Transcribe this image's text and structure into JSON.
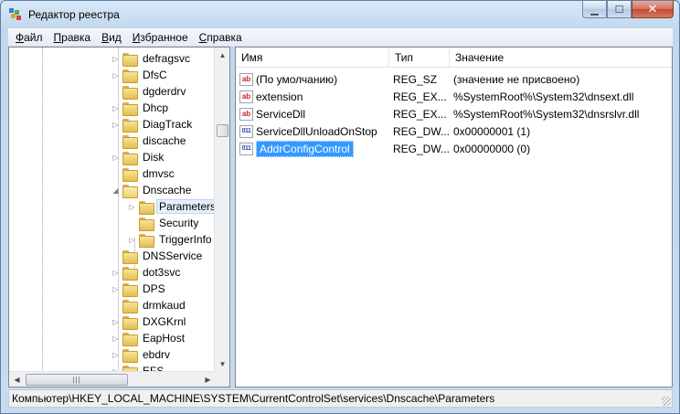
{
  "window": {
    "title": "Редактор реестра"
  },
  "caption": {
    "minimize": "▁",
    "maximize": "☐",
    "close": "✕"
  },
  "menu": [
    {
      "first": "Ф",
      "rest": "айл"
    },
    {
      "first": "П",
      "rest": "равка"
    },
    {
      "first": "В",
      "rest": "ид"
    },
    {
      "first": "И",
      "rest": "збранное"
    },
    {
      "first": "С",
      "rest": "правка"
    }
  ],
  "tree": {
    "items": [
      {
        "label": "defragsvc",
        "expander": "▷",
        "level": 0
      },
      {
        "label": "DfsC",
        "expander": "▷",
        "level": 0
      },
      {
        "label": "dgderdrv",
        "expander": "",
        "level": 0
      },
      {
        "label": "Dhcp",
        "expander": "▷",
        "level": 0
      },
      {
        "label": "DiagTrack",
        "expander": "▷",
        "level": 0
      },
      {
        "label": "discache",
        "expander": "",
        "level": 0
      },
      {
        "label": "Disk",
        "expander": "▷",
        "level": 0
      },
      {
        "label": "dmvsc",
        "expander": "",
        "level": 0
      },
      {
        "label": "Dnscache",
        "expander": "◢",
        "level": 0
      },
      {
        "label": "Parameters",
        "expander": "▷",
        "level": 1,
        "selected": true
      },
      {
        "label": "Security",
        "expander": "",
        "level": 1
      },
      {
        "label": "TriggerInfo",
        "expander": "▷",
        "level": 1
      },
      {
        "label": "DNSService",
        "expander": "",
        "level": 0
      },
      {
        "label": "dot3svc",
        "expander": "▷",
        "level": 0
      },
      {
        "label": "DPS",
        "expander": "▷",
        "level": 0
      },
      {
        "label": "drmkaud",
        "expander": "",
        "level": 0
      },
      {
        "label": "DXGKrnl",
        "expander": "▷",
        "level": 0
      },
      {
        "label": "EapHost",
        "expander": "▷",
        "level": 0
      },
      {
        "label": "ebdrv",
        "expander": "▷",
        "level": 0
      },
      {
        "label": "EFS",
        "expander": "▷",
        "level": 0
      }
    ]
  },
  "list": {
    "columns": [
      "Имя",
      "Тип",
      "Значение"
    ],
    "rows": [
      {
        "icon": "ab",
        "kind": "sz",
        "name": "(По умолчанию)",
        "type": "REG_SZ",
        "value": "(значение не присвоено)"
      },
      {
        "icon": "ab",
        "kind": "sz",
        "name": "extension",
        "type": "REG_EX...",
        "value": "%SystemRoot%\\System32\\dnsext.dll"
      },
      {
        "icon": "ab",
        "kind": "sz",
        "name": "ServiceDll",
        "type": "REG_EX...",
        "value": "%SystemRoot%\\System32\\dnsrslvr.dll"
      },
      {
        "icon": "011",
        "kind": "dw",
        "name": "ServiceDllUnloadOnStop",
        "type": "REG_DW...",
        "value": "0x00000001 (1)"
      },
      {
        "icon": "011",
        "kind": "dw",
        "name": "AddrConfigControl",
        "type": "REG_DW...",
        "value": "0x00000000 (0)",
        "selected": true
      }
    ]
  },
  "statusbar": {
    "path": "Компьютер\\HKEY_LOCAL_MACHINE\\SYSTEM\\CurrentControlSet\\services\\Dnscache\\Parameters"
  },
  "scroll": {
    "up": "▲",
    "down": "▼",
    "left": "◀",
    "right": "▶",
    "grip": "|||"
  }
}
